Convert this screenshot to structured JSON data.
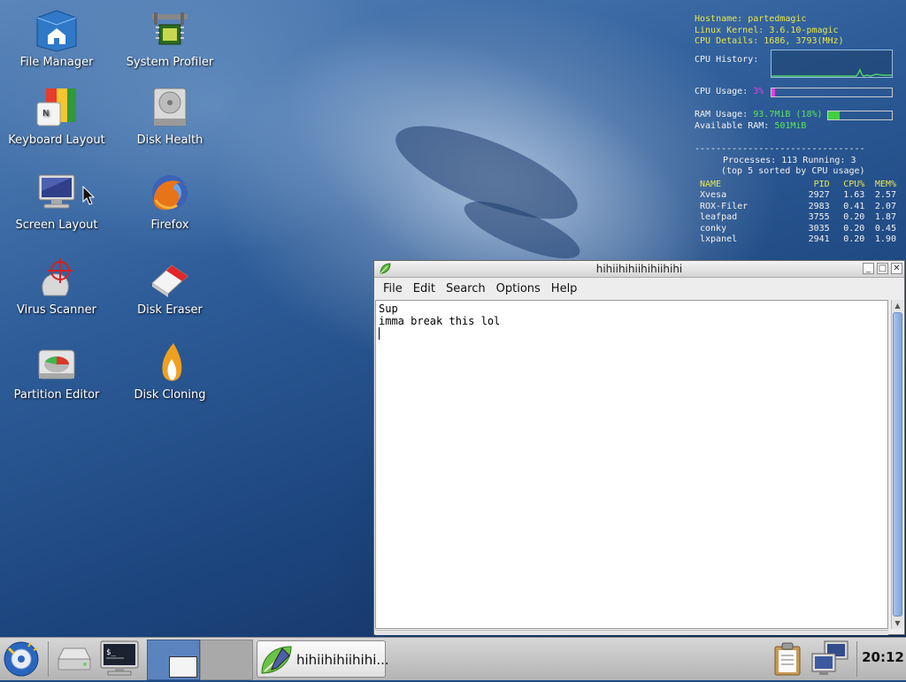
{
  "desktop_icons": [
    {
      "label": "File Manager",
      "icon": "house-folder-icon"
    },
    {
      "label": "System Profiler",
      "icon": "caliper-chip-icon"
    },
    {
      "label": "Keyboard Layout",
      "icon": "keyboard-flag-icon"
    },
    {
      "label": "Disk Health",
      "icon": "hard-drive-icon"
    },
    {
      "label": "Screen Layout",
      "icon": "monitor-icon"
    },
    {
      "label": "Firefox",
      "icon": "firefox-icon"
    },
    {
      "label": "Virus Scanner",
      "icon": "crosshair-scanner-icon"
    },
    {
      "label": "Disk Eraser",
      "icon": "eraser-icon"
    },
    {
      "label": "Partition Editor",
      "icon": "partition-disk-icon"
    },
    {
      "label": "Disk Cloning",
      "icon": "flame-drop-icon"
    }
  ],
  "conky": {
    "hostname_label": "Hostname:",
    "hostname": "partedmagic",
    "kernel_label": "Linux Kernel:",
    "kernel": "3.6.10-pmagic",
    "cpu_details_label": "CPU Details:",
    "cpu_details": "1686, 3793(MHz)",
    "cpu_history_label": "CPU History:",
    "cpu_usage_label": "CPU Usage:",
    "cpu_usage": "3%",
    "cpu_usage_fraction": 0.03,
    "ram_usage_label": "RAM Usage:",
    "ram_usage": "93.7MiB (18%)",
    "ram_usage_fraction": 0.18,
    "avail_ram_label": "Available RAM:",
    "avail_ram": "501MiB",
    "divider": "--------------------------------",
    "processes_line": "Processes: 113  Running: 3",
    "top_line": "(top 5 sorted by CPU usage)",
    "columns": [
      "NAME",
      "PID",
      "CPU%",
      "MEM%"
    ],
    "processes": [
      [
        "Xvesa",
        "2927",
        "1.63",
        "2.57"
      ],
      [
        "ROX-Filer",
        "2983",
        "0.41",
        "2.07"
      ],
      [
        "leafpad",
        "3755",
        "0.20",
        "1.87"
      ],
      [
        "conky",
        "3035",
        "0.20",
        "0.45"
      ],
      [
        "lxpanel",
        "2941",
        "0.20",
        "1.90"
      ]
    ],
    "colors": {
      "accent_yellow": "#e6e650",
      "cpu_bar": "#e040e0",
      "ram_bar": "#40d040"
    }
  },
  "window": {
    "title": "hihiihihiihihiihihi",
    "menu": [
      "File",
      "Edit",
      "Search",
      "Options",
      "Help"
    ],
    "text_lines": [
      "Sup",
      "imma break this lol",
      ""
    ]
  },
  "taskbar": {
    "task_label": "hihiihihiihihi...",
    "clock": "20:12"
  }
}
